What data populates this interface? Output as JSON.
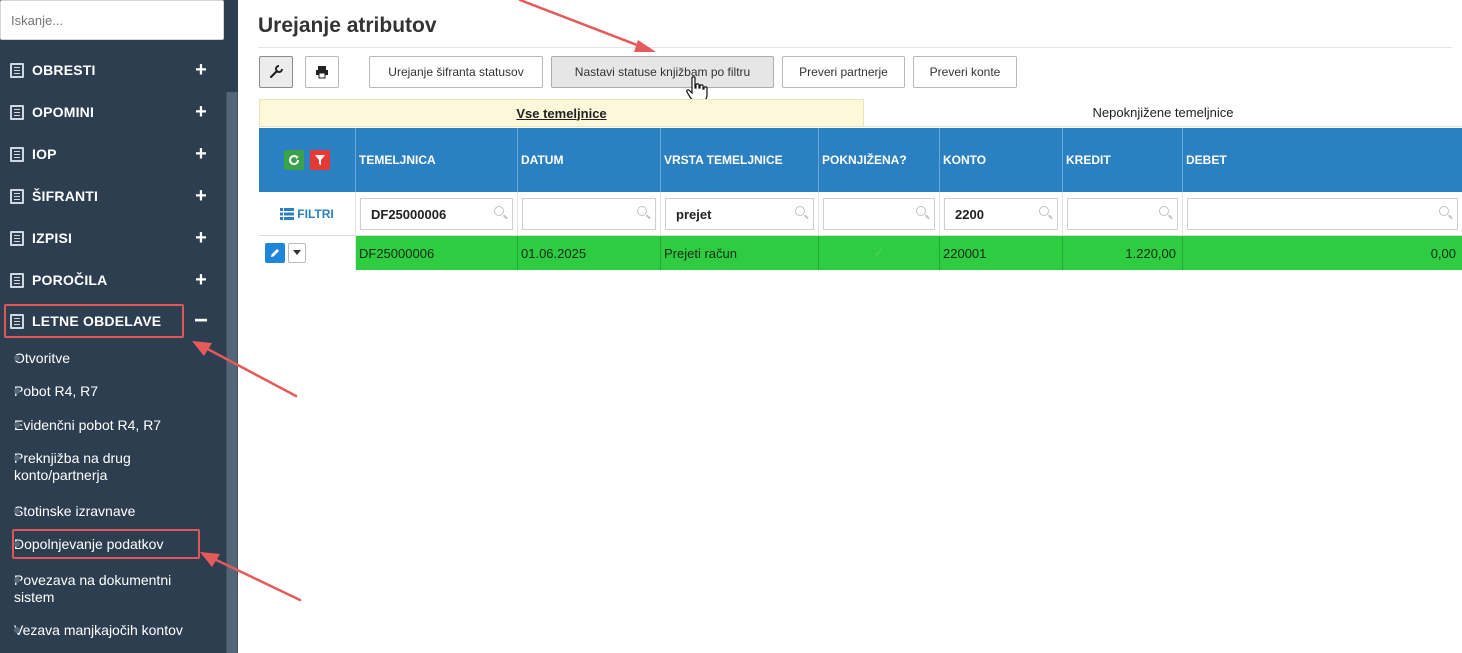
{
  "sidebar": {
    "search_placeholder": "Iskanje...",
    "items": [
      {
        "label": "OBRESTI",
        "toggle": "+"
      },
      {
        "label": "OPOMINI",
        "toggle": "+"
      },
      {
        "label": "IOP",
        "toggle": "+"
      },
      {
        "label": "ŠIFRANTI",
        "toggle": "+"
      },
      {
        "label": "IZPISI",
        "toggle": "+"
      },
      {
        "label": "POROČILA",
        "toggle": "+"
      },
      {
        "label": "LETNE OBDELAVE",
        "toggle": "−"
      }
    ],
    "sub_items": [
      "Otvoritve",
      "Pobot R4, R7",
      "Evidenčni pobot R4, R7",
      "Preknjižba na drug konto/partnerja",
      "Stotinske izravnave",
      "Dopolnjevanje podatkov",
      "Povezava na dokumentni sistem",
      "Vezava manjkajočih kontov"
    ]
  },
  "main": {
    "title": "Urejanje atributov",
    "toolbar": {
      "buttons": [
        "Urejanje šifranta statusov",
        "Nastavi statuse knjižbam po filtru",
        "Preveri partnerje",
        "Preveri konte"
      ]
    },
    "tabs": [
      {
        "label": "Vse temeljnice",
        "active": true
      },
      {
        "label": "Nepoknjižene temeljnice",
        "active": false
      }
    ],
    "grid": {
      "columns": [
        "TEMELJNICA",
        "DATUM",
        "VRSTA TEMELJNICE",
        "POKNJIŽENA?",
        "KONTO",
        "KREDIT",
        "DEBET"
      ],
      "filter_label": "FILTRI",
      "filters": [
        "DF25000006",
        "",
        "prejet",
        "",
        "2200",
        "",
        ""
      ],
      "rows": [
        {
          "temeljnica": "DF25000006",
          "datum": "01.06.2025",
          "vrsta": "Prejeti račun",
          "poknjizena": "✓",
          "konto": "220001",
          "kredit": "1.220,00",
          "debet": "0,00"
        }
      ]
    }
  },
  "colors": {
    "sidebar_bg": "#2c3e4f",
    "header_blue": "#2b80c1",
    "row_green": "#2ecc40",
    "tab_active_bg": "#fcf8d9",
    "annotation_red": "#e0565a"
  }
}
